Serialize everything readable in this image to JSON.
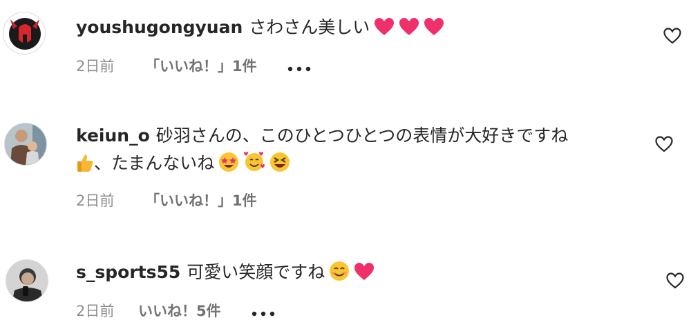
{
  "comments": [
    {
      "username": "youshugongyuan",
      "text": "さわさん美しい",
      "emojis": [
        "heart-emoji",
        "heart-emoji",
        "heart-emoji"
      ],
      "time": "2日前",
      "likes": "「いいね！」1件",
      "avatar": "spartan-helmet-logo"
    },
    {
      "username": "keiun_o",
      "text_line1": "砂羽さんの、このひとつひとつの表情が大好きですね",
      "text_line2": "、たまんないね",
      "emojis_line2_lead": [
        "thumbs-up-emoji"
      ],
      "emojis_line2_trail": [
        "star-struck-emoji",
        "smiling-face-with-hearts-emoji",
        "grinning-squinting-face-emoji"
      ],
      "time": "2日前",
      "likes": "「いいね！」1件",
      "avatar": "person-with-child-photo"
    },
    {
      "username": "s_sports55",
      "text": "可愛い笑顔ですね",
      "emojis": [
        "smiling-face-emoji",
        "heart-emoji"
      ],
      "time": "2日前",
      "likes": "いいね！5件",
      "avatar": "person-photo"
    }
  ],
  "colors": {
    "text": "#262626",
    "meta": "#8e8e8e",
    "heart_emoji": "#f0306a"
  }
}
